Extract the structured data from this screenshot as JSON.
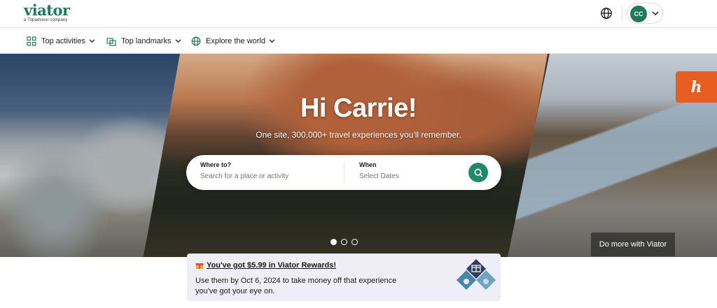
{
  "header": {
    "logo_text": "viator",
    "logo_tagline": "a Tripadvisor company",
    "language_icon": "globe-icon",
    "account_initials": "CC"
  },
  "nav": {
    "items": [
      {
        "label": "Top activities",
        "icon": "grid-icon"
      },
      {
        "label": "Top landmarks",
        "icon": "landmark-icon"
      },
      {
        "label": "Explore the world",
        "icon": "globe-icon"
      }
    ]
  },
  "hero": {
    "title": "Hi Carrie!",
    "subtitle": "One site, 300,000+ travel experiences you'll remember.",
    "search": {
      "where_label": "Where to?",
      "where_placeholder": "Search for a place or activity",
      "when_label": "When",
      "when_placeholder": "Select Dates"
    },
    "carousel_dots": 3,
    "carousel_active": 0,
    "cta": "Do more with Viator",
    "side_tab_letter": "h"
  },
  "rewards": {
    "title": "You've got $5.99 in Viator Rewards!",
    "body": "Use them by Oct 6, 2024 to take money off that experience you've got your eye on."
  },
  "colors": {
    "brand_green": "#1f7a5c",
    "search_button": "#1f8a6a",
    "side_tab": "#e85d21",
    "rewards_bg": "#efedf5"
  }
}
